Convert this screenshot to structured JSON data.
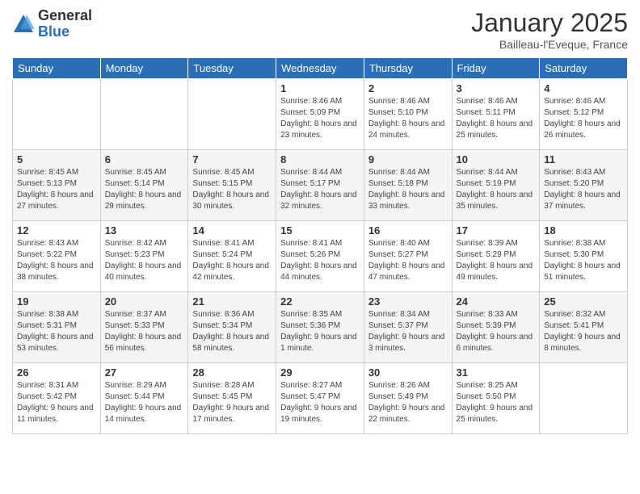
{
  "logo": {
    "general": "General",
    "blue": "Blue"
  },
  "header": {
    "title": "January 2025",
    "location": "Bailleau-l'Eveque, France"
  },
  "weekdays": [
    "Sunday",
    "Monday",
    "Tuesday",
    "Wednesday",
    "Thursday",
    "Friday",
    "Saturday"
  ],
  "weeks": [
    [
      {
        "day": "",
        "info": ""
      },
      {
        "day": "",
        "info": ""
      },
      {
        "day": "",
        "info": ""
      },
      {
        "day": "1",
        "info": "Sunrise: 8:46 AM\nSunset: 5:09 PM\nDaylight: 8 hours\nand 23 minutes."
      },
      {
        "day": "2",
        "info": "Sunrise: 8:46 AM\nSunset: 5:10 PM\nDaylight: 8 hours\nand 24 minutes."
      },
      {
        "day": "3",
        "info": "Sunrise: 8:46 AM\nSunset: 5:11 PM\nDaylight: 8 hours\nand 25 minutes."
      },
      {
        "day": "4",
        "info": "Sunrise: 8:46 AM\nSunset: 5:12 PM\nDaylight: 8 hours\nand 26 minutes."
      }
    ],
    [
      {
        "day": "5",
        "info": "Sunrise: 8:45 AM\nSunset: 5:13 PM\nDaylight: 8 hours\nand 27 minutes."
      },
      {
        "day": "6",
        "info": "Sunrise: 8:45 AM\nSunset: 5:14 PM\nDaylight: 8 hours\nand 29 minutes."
      },
      {
        "day": "7",
        "info": "Sunrise: 8:45 AM\nSunset: 5:15 PM\nDaylight: 8 hours\nand 30 minutes."
      },
      {
        "day": "8",
        "info": "Sunrise: 8:44 AM\nSunset: 5:17 PM\nDaylight: 8 hours\nand 32 minutes."
      },
      {
        "day": "9",
        "info": "Sunrise: 8:44 AM\nSunset: 5:18 PM\nDaylight: 8 hours\nand 33 minutes."
      },
      {
        "day": "10",
        "info": "Sunrise: 8:44 AM\nSunset: 5:19 PM\nDaylight: 8 hours\nand 35 minutes."
      },
      {
        "day": "11",
        "info": "Sunrise: 8:43 AM\nSunset: 5:20 PM\nDaylight: 8 hours\nand 37 minutes."
      }
    ],
    [
      {
        "day": "12",
        "info": "Sunrise: 8:43 AM\nSunset: 5:22 PM\nDaylight: 8 hours\nand 38 minutes."
      },
      {
        "day": "13",
        "info": "Sunrise: 8:42 AM\nSunset: 5:23 PM\nDaylight: 8 hours\nand 40 minutes."
      },
      {
        "day": "14",
        "info": "Sunrise: 8:41 AM\nSunset: 5:24 PM\nDaylight: 8 hours\nand 42 minutes."
      },
      {
        "day": "15",
        "info": "Sunrise: 8:41 AM\nSunset: 5:26 PM\nDaylight: 8 hours\nand 44 minutes."
      },
      {
        "day": "16",
        "info": "Sunrise: 8:40 AM\nSunset: 5:27 PM\nDaylight: 8 hours\nand 47 minutes."
      },
      {
        "day": "17",
        "info": "Sunrise: 8:39 AM\nSunset: 5:29 PM\nDaylight: 8 hours\nand 49 minutes."
      },
      {
        "day": "18",
        "info": "Sunrise: 8:38 AM\nSunset: 5:30 PM\nDaylight: 8 hours\nand 51 minutes."
      }
    ],
    [
      {
        "day": "19",
        "info": "Sunrise: 8:38 AM\nSunset: 5:31 PM\nDaylight: 8 hours\nand 53 minutes."
      },
      {
        "day": "20",
        "info": "Sunrise: 8:37 AM\nSunset: 5:33 PM\nDaylight: 8 hours\nand 56 minutes."
      },
      {
        "day": "21",
        "info": "Sunrise: 8:36 AM\nSunset: 5:34 PM\nDaylight: 8 hours\nand 58 minutes."
      },
      {
        "day": "22",
        "info": "Sunrise: 8:35 AM\nSunset: 5:36 PM\nDaylight: 9 hours\nand 1 minute."
      },
      {
        "day": "23",
        "info": "Sunrise: 8:34 AM\nSunset: 5:37 PM\nDaylight: 9 hours\nand 3 minutes."
      },
      {
        "day": "24",
        "info": "Sunrise: 8:33 AM\nSunset: 5:39 PM\nDaylight: 9 hours\nand 6 minutes."
      },
      {
        "day": "25",
        "info": "Sunrise: 8:32 AM\nSunset: 5:41 PM\nDaylight: 9 hours\nand 8 minutes."
      }
    ],
    [
      {
        "day": "26",
        "info": "Sunrise: 8:31 AM\nSunset: 5:42 PM\nDaylight: 9 hours\nand 11 minutes."
      },
      {
        "day": "27",
        "info": "Sunrise: 8:29 AM\nSunset: 5:44 PM\nDaylight: 9 hours\nand 14 minutes."
      },
      {
        "day": "28",
        "info": "Sunrise: 8:28 AM\nSunset: 5:45 PM\nDaylight: 9 hours\nand 17 minutes."
      },
      {
        "day": "29",
        "info": "Sunrise: 8:27 AM\nSunset: 5:47 PM\nDaylight: 9 hours\nand 19 minutes."
      },
      {
        "day": "30",
        "info": "Sunrise: 8:26 AM\nSunset: 5:49 PM\nDaylight: 9 hours\nand 22 minutes."
      },
      {
        "day": "31",
        "info": "Sunrise: 8:25 AM\nSunset: 5:50 PM\nDaylight: 9 hours\nand 25 minutes."
      },
      {
        "day": "",
        "info": ""
      }
    ]
  ]
}
